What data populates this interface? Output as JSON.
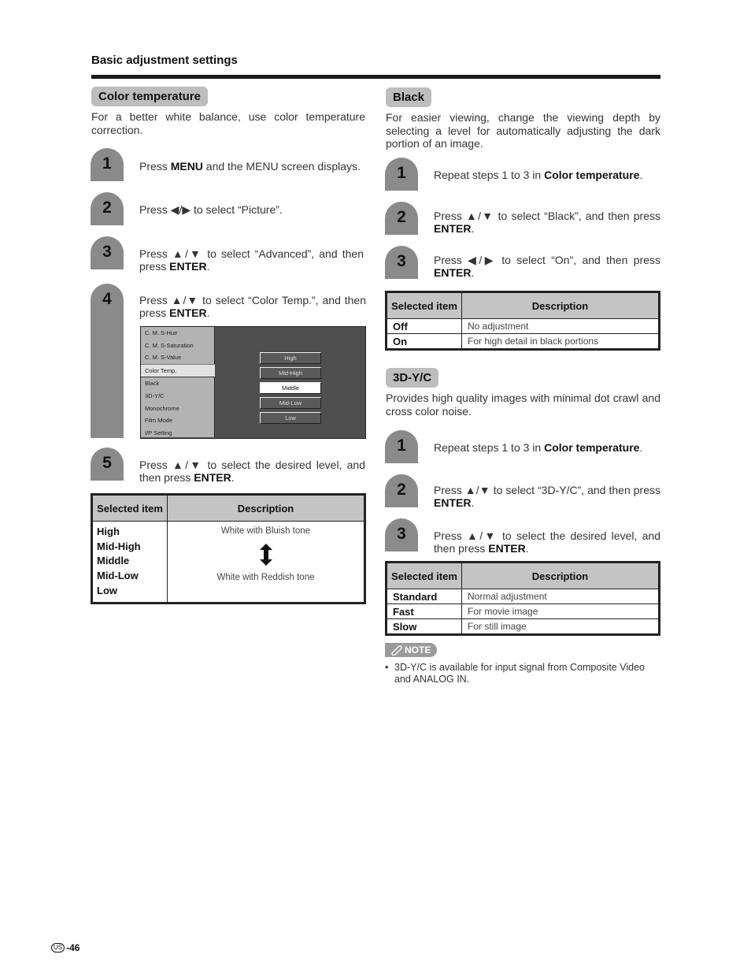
{
  "page": {
    "section_title": "Basic adjustment settings",
    "footer": {
      "region": "US",
      "page_number": "-46"
    }
  },
  "color_temperature": {
    "title": "Color temperature",
    "intro": "For a better white balance, use color temperature correction.",
    "steps": [
      {
        "num": "1",
        "pre": "Press ",
        "bold": "MENU",
        "post": " and the MENU screen displays."
      },
      {
        "num": "2",
        "pre": "Press ◀/▶ to select “Picture”.",
        "bold": "",
        "post": ""
      },
      {
        "num": "3",
        "pre": "Press ▲/▼ to select “Advanced”, and then press ",
        "bold": "ENTER",
        "post": "."
      },
      {
        "num": "4",
        "pre": "Press ▲/▼ to select “Color Temp.”, and then press ",
        "bold": "ENTER",
        "post": "."
      },
      {
        "num": "5",
        "pre": "Press ▲/▼ to select the desired level, and then press ",
        "bold": "ENTER",
        "post": "."
      }
    ],
    "menu": {
      "items": [
        "C. M. S-Hue",
        "C. M. S-Saturation",
        "C. M. S-Value",
        "Color Temp.",
        "Black",
        "3D-Y/C",
        "Monochrome",
        "Film Mode",
        "I/P Setting"
      ],
      "selected_item": "Color Temp.",
      "options": [
        "High",
        "Mid-High",
        "Middle",
        "Mid-Low",
        "Low"
      ],
      "selected_option": "Middle"
    },
    "table": {
      "headers": [
        "Selected item",
        "Description"
      ],
      "items": [
        "High",
        "Mid-High",
        "Middle",
        "Mid-Low",
        "Low"
      ],
      "desc_top": "White with Bluish tone",
      "desc_bottom": "White with Reddish tone",
      "arrow_icon": "up-down-arrow"
    }
  },
  "black": {
    "title": "Black",
    "intro": "For easier viewing, change the viewing depth by selecting a level for automatically adjusting the dark portion of an image.",
    "steps": [
      {
        "num": "1",
        "pre": "Repeat steps  1 to 3 in ",
        "bold": "Color temperature",
        "post": "."
      },
      {
        "num": "2",
        "pre": "Press ▲/▼ to select “Black”, and then press ",
        "bold": "ENTER",
        "post": "."
      },
      {
        "num": "3",
        "pre": "Press ◀/▶ to select “On”, and then press ",
        "bold": "ENTER",
        "post": "."
      }
    ],
    "table": {
      "headers": [
        "Selected item",
        "Description"
      ],
      "rows": [
        {
          "item": "Off",
          "desc": "No adjustment"
        },
        {
          "item": "On",
          "desc": "For high detail in black portions"
        }
      ]
    }
  },
  "yc3d": {
    "title": "3D-Y/C",
    "intro": "Provides high quality images with minimal dot crawl and cross color noise.",
    "steps": [
      {
        "num": "1",
        "pre": "Repeat steps  1 to 3 in ",
        "bold": "Color temperature",
        "post": "."
      },
      {
        "num": "2",
        "pre": "Press ▲/▼ to select “3D-Y/C”, and then press ",
        "bold": "ENTER",
        "post": "."
      },
      {
        "num": "3",
        "pre": "Press ▲/▼ to select the desired level, and then press ",
        "bold": "ENTER",
        "post": "."
      }
    ],
    "table": {
      "headers": [
        "Selected item",
        "Description"
      ],
      "rows": [
        {
          "item": "Standard",
          "desc": "Normal adjustment"
        },
        {
          "item": "Fast",
          "desc": "For movie image"
        },
        {
          "item": "Slow",
          "desc": "For still image"
        }
      ]
    },
    "note": {
      "label": "NOTE",
      "items": [
        "3D-Y/C is available for input signal from Composite Video and ANALOG IN."
      ]
    }
  }
}
